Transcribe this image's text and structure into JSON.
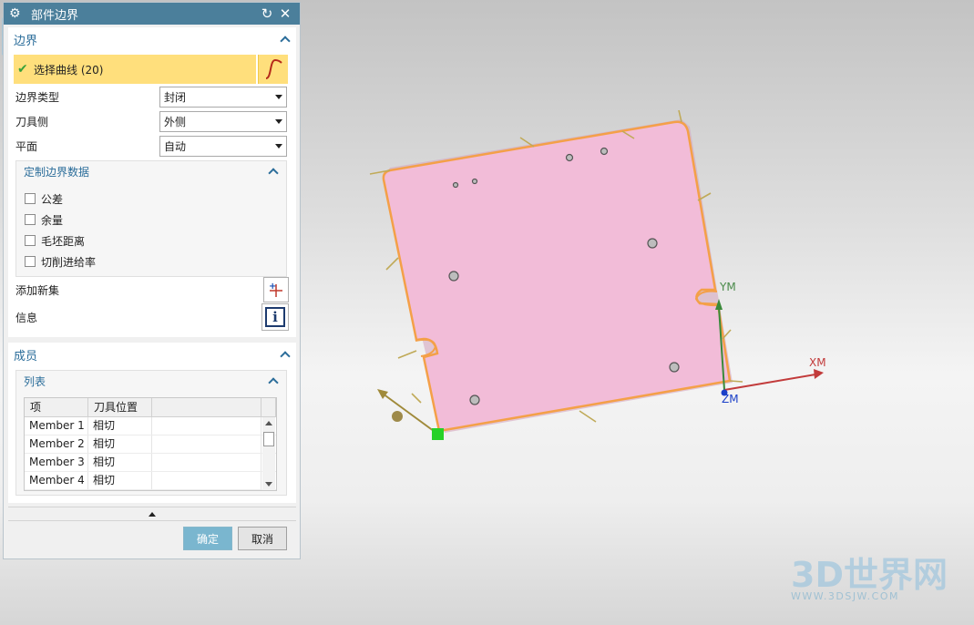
{
  "dialog": {
    "title": "部件边界",
    "reset_icon": "reset-icon",
    "close_icon": "close-icon"
  },
  "boundary_group": {
    "title": "边界",
    "select_curve_label": "选择曲线 (20)",
    "fields": [
      {
        "label": "边界类型",
        "value": "封闭"
      },
      {
        "label": "刀具侧",
        "value": "外侧"
      },
      {
        "label": "平面",
        "value": "自动"
      }
    ],
    "custom_data": {
      "title": "定制边界数据",
      "options": [
        "公差",
        "余量",
        "毛坯距离",
        "切削进给率"
      ]
    },
    "add_new_set_label": "添加新集",
    "info_label": "信息"
  },
  "members_group": {
    "title": "成员",
    "list_title": "列表",
    "columns": [
      "项",
      "刀具位置"
    ],
    "rows": [
      {
        "item": "Member 1",
        "position": "相切"
      },
      {
        "item": "Member 2",
        "position": "相切"
      },
      {
        "item": "Member 3",
        "position": "相切"
      },
      {
        "item": "Member 4",
        "position": "相切"
      }
    ]
  },
  "buttons": {
    "ok": "确定",
    "cancel": "取消"
  },
  "viewport": {
    "axis_labels": {
      "ym": "YM",
      "xm": "XM",
      "zm": "ZM"
    },
    "colors": {
      "part_fill": "#f2bcd8",
      "boundary": "#f4a048",
      "accent": "#4b7f9b"
    }
  },
  "watermark": {
    "brand": "3D世界网",
    "url": "WWW.3DSJW.COM"
  }
}
